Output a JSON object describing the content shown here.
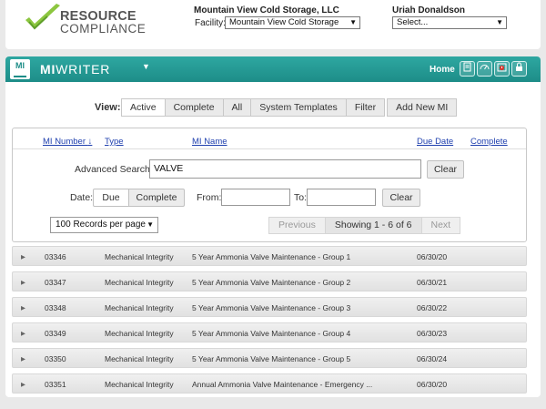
{
  "header": {
    "logo_line1": "RESOURCE",
    "logo_line2": "COMPLIANCE",
    "company": "Mountain View Cold Storage, LLC",
    "facility_label": "Facility:",
    "facility_value": "Mountain View Cold Storage",
    "user_name": "Uriah Donaldson",
    "user_select_value": "Select..."
  },
  "appbar": {
    "badge": "MI",
    "title_bold": "MI",
    "title_rest": "WRITER",
    "home": "Home",
    "tool_icons": [
      "clipboard-icon",
      "gauge-icon",
      "alert-calendar-icon",
      "lock-icon"
    ]
  },
  "view": {
    "label": "View:",
    "tabs": [
      "Active",
      "Complete",
      "All",
      "System Templates",
      "Filter"
    ],
    "add_button": "Add New MI"
  },
  "columns": {
    "mi_number": "MI Number",
    "sort_arrow": "↓",
    "type": "Type",
    "mi_name": "MI Name",
    "due_date": "Due Date",
    "complete": "Complete"
  },
  "search": {
    "label": "Advanced Search:",
    "value": "VALVE",
    "clear": "Clear"
  },
  "date_filter": {
    "label": "Date:",
    "due": "Due",
    "complete": "Complete",
    "from_label": "From:",
    "to_label": "To:",
    "from_value": "",
    "to_value": "",
    "clear": "Clear"
  },
  "paging": {
    "records": "100 Records per page",
    "previous": "Previous",
    "info": "Showing 1 - 6 of 6",
    "next": "Next"
  },
  "rows": [
    {
      "number": "03346",
      "type": "Mechanical Integrity",
      "name": "5 Year Ammonia Valve Maintenance - Group 1",
      "due": "06/30/20"
    },
    {
      "number": "03347",
      "type": "Mechanical Integrity",
      "name": "5 Year Ammonia Valve Maintenance - Group 2",
      "due": "06/30/21"
    },
    {
      "number": "03348",
      "type": "Mechanical Integrity",
      "name": "5 Year Ammonia Valve Maintenance - Group 3",
      "due": "06/30/22"
    },
    {
      "number": "03349",
      "type": "Mechanical Integrity",
      "name": "5 Year Ammonia Valve Maintenance - Group 4",
      "due": "06/30/23"
    },
    {
      "number": "03350",
      "type": "Mechanical Integrity",
      "name": "5 Year Ammonia Valve Maintenance - Group 5",
      "due": "06/30/24"
    },
    {
      "number": "03351",
      "type": "Mechanical Integrity",
      "name": "Annual Ammonia Valve Maintenance - Emergency ...",
      "due": "06/30/20"
    }
  ]
}
